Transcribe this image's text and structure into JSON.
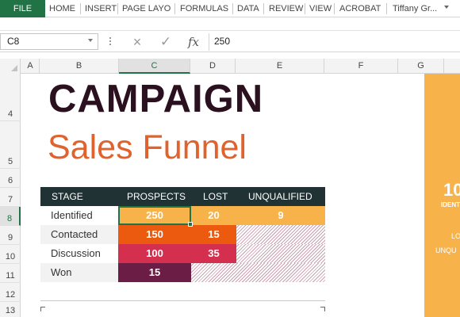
{
  "ribbon": {
    "file_tab": "FILE",
    "tabs": [
      "HOME",
      "INSERT",
      "PAGE LAYO",
      "FORMULAS",
      "DATA",
      "REVIEW",
      "VIEW",
      "ACROBAT"
    ],
    "user": "Tiffany Gr..."
  },
  "formula_bar": {
    "name_box": "C8",
    "cancel_icon": "×",
    "enter_icon": "✓",
    "fx_label": "fx",
    "value": "250"
  },
  "grid": {
    "columns": [
      "A",
      "B",
      "C",
      "D",
      "E",
      "F",
      "G"
    ],
    "selected_column": "C",
    "rows": [
      "4",
      "5",
      "6",
      "7",
      "8",
      "9",
      "10",
      "11",
      "12",
      "13"
    ],
    "selected_row": "8"
  },
  "sheet": {
    "title": "CAMPAIGN",
    "subtitle": "Sales Funnel",
    "table": {
      "headers": [
        "STAGE",
        "PROSPECTS",
        "LOST",
        "UNQUALIFIED"
      ],
      "rows": [
        {
          "stage": "Identified",
          "prospects": "250",
          "lost": "20",
          "unqualified": "9"
        },
        {
          "stage": "Contacted",
          "prospects": "150",
          "lost": "15"
        },
        {
          "stage": "Discussion",
          "prospects": "100",
          "lost": "35"
        },
        {
          "stage": "Won",
          "prospects": "15"
        }
      ]
    },
    "side_panel": {
      "big_number": "10",
      "label_1": "IDENT",
      "label_2": "LO",
      "label_3": "UNQU"
    }
  },
  "colors": {
    "excel_green": "#217346",
    "title_dark": "#2b1020",
    "subtitle_orange": "#e0622d",
    "table_header": "#203234",
    "identified": "#f7b34a",
    "contacted": "#ec5a10",
    "discussion": "#d42f4f",
    "won": "#6b1d46",
    "side_panel": "#f7b34a"
  }
}
